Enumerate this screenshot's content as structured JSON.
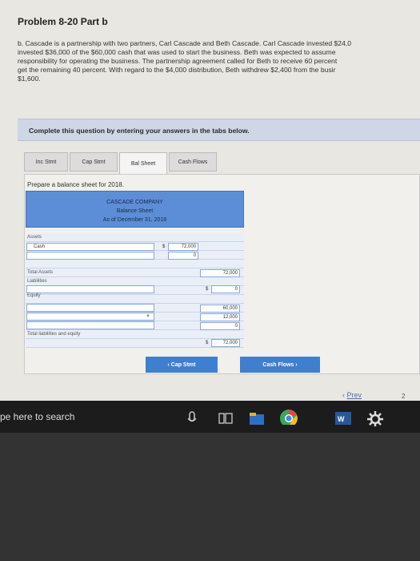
{
  "problem": {
    "title": "Problem 8-20 Part b",
    "text_lines": [
      "b. Cascade is a partnership with two partners, Carl Cascade and Beth Cascade. Carl Cascade invested $24,0",
      "invested $36,000 of the $60,000 cash that was used to start the business. Beth was expected to assume",
      "responsibility for operating the business. The partnership agreement called for Beth to receive 60 percent",
      "get the remaining 40 percent. With regard to the $4,000 distribution, Beth withdrew $2,400 from the busir",
      "$1,600."
    ]
  },
  "instruction": "Complete this question by entering your answers in the tabs below.",
  "tabs": [
    {
      "label": "Inc Stmt"
    },
    {
      "label": "Cap Stmt"
    },
    {
      "label": "Bal Sheet"
    },
    {
      "label": "Cash Flows"
    }
  ],
  "prompt": "Prepare a balance sheet for 2018.",
  "sheet": {
    "company": "CASCADE COMPANY",
    "title": "Balance Sheet",
    "date": "As of December 31, 2018",
    "assets_label": "Assets",
    "cash_label": "Cash",
    "dollar": "$",
    "cash_value": "72,000",
    "zero": "0",
    "total_assets_label": "Total Assets",
    "total_assets_value": "72,000",
    "liabilities_label": "Liabilities",
    "liabilities_value": "0",
    "equity_label": "Equity",
    "equity_value_1": "60,000",
    "equity_value_2": "12,000",
    "equity_value_3": "0",
    "total_le_label": "Total liabilities and equity",
    "total_le_value": "72,000"
  },
  "nav": {
    "prev_tab": "Cap Stmt",
    "next_tab": "Cash Flows",
    "prev_page": "Prev",
    "page_number": "2"
  },
  "taskbar": {
    "search_placeholder": "pe here to search"
  }
}
